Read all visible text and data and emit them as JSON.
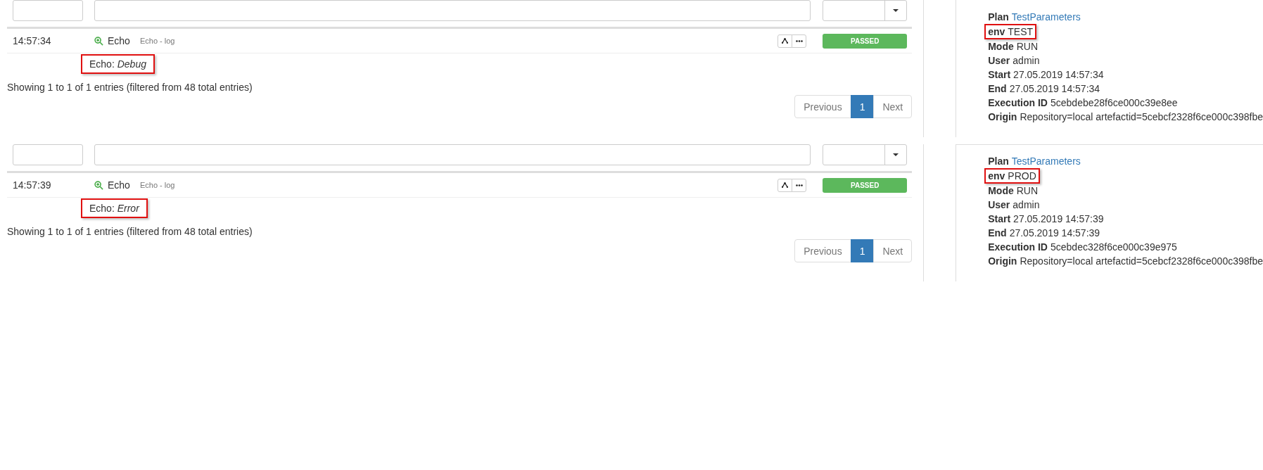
{
  "runs": [
    {
      "rows": [
        {
          "time": "14:57:34",
          "name": "Echo",
          "description": "Echo - log",
          "message": "Echo: *Debug*",
          "highlighted": true,
          "status": "PASSED"
        }
      ],
      "info": "Showing 1 to 1 of 1 entries (filtered from 48 total entries)",
      "pagination": [
        {
          "label": "Previous",
          "selected": false
        },
        {
          "label": "1",
          "selected": true
        },
        {
          "label": "Next",
          "selected": false
        }
      ],
      "details": [
        {
          "label": "Plan",
          "value": "TestParameters",
          "kind": "link",
          "highlighted": false
        },
        {
          "label": "env",
          "value": "TEST",
          "kind": "text",
          "highlighted": true
        },
        {
          "label": "Mode",
          "value": "RUN",
          "kind": "text",
          "highlighted": false
        },
        {
          "label": "User",
          "value": "admin",
          "kind": "text",
          "highlighted": false
        },
        {
          "label": "Start",
          "value": "27.05.2019 14:57:34",
          "kind": "text",
          "highlighted": false
        },
        {
          "label": "End",
          "value": "27.05.2019 14:57:34",
          "kind": "text",
          "highlighted": false
        },
        {
          "label": "Execution ID",
          "value": "5cebdebe28f6ce000c39e8ee",
          "kind": "text",
          "highlighted": false
        },
        {
          "label": "Origin",
          "value": "Repository=local artefactid=5cebcf2328f6ce000c398fbe",
          "kind": "text",
          "highlighted": false
        }
      ]
    },
    {
      "rows": [
        {
          "time": "14:57:39",
          "name": "Echo",
          "description": "Echo - log",
          "message": "Echo: *Error*",
          "highlighted": true,
          "status": "PASSED"
        }
      ],
      "info": "Showing 1 to 1 of 1 entries (filtered from 48 total entries)",
      "pagination": [
        {
          "label": "Previous",
          "selected": false
        },
        {
          "label": "1",
          "selected": true
        },
        {
          "label": "Next",
          "selected": false
        }
      ],
      "details": [
        {
          "label": "Plan",
          "value": "TestParameters",
          "kind": "link",
          "highlighted": false
        },
        {
          "label": "env",
          "value": "PROD",
          "kind": "text",
          "highlighted": true
        },
        {
          "label": "Mode",
          "value": "RUN",
          "kind": "text",
          "highlighted": false
        },
        {
          "label": "User",
          "value": "admin",
          "kind": "text",
          "highlighted": false
        },
        {
          "label": "Start",
          "value": "27.05.2019 14:57:39",
          "kind": "text",
          "highlighted": false
        },
        {
          "label": "End",
          "value": "27.05.2019 14:57:39",
          "kind": "text",
          "highlighted": false
        },
        {
          "label": "Execution ID",
          "value": "5cebdec328f6ce000c39e975",
          "kind": "text",
          "highlighted": false
        },
        {
          "label": "Origin",
          "value": "Repository=local artefactid=5cebcf2328f6ce000c398fbe",
          "kind": "text",
          "highlighted": false
        }
      ]
    }
  ]
}
